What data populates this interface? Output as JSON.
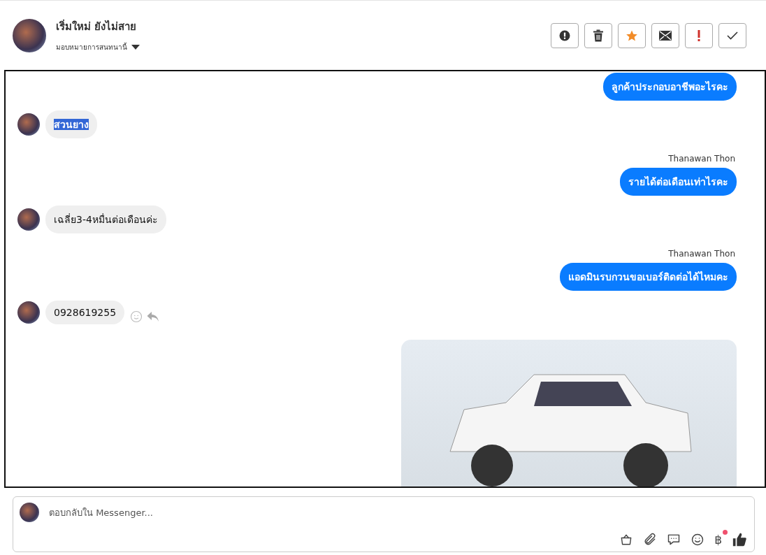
{
  "header": {
    "name": "เริ่มใหม่ ยังไม่สาย",
    "assign_label": "มอบหมายการสนทนานี้"
  },
  "actions": [
    {
      "kind": "alert"
    },
    {
      "kind": "trash"
    },
    {
      "kind": "star"
    },
    {
      "kind": "mail"
    },
    {
      "kind": "exclaim"
    },
    {
      "kind": "check"
    }
  ],
  "messages": [
    {
      "kind": "outgoing",
      "text": "ลูกค้าประกอบอาชีพอะไรคะ"
    },
    {
      "kind": "incoming",
      "text": "สวนยาง",
      "highlighted": true,
      "reactions": false
    },
    {
      "kind": "outgoing",
      "sender": "Thanawan Thon",
      "text": "รายได้ต่อเดือนเท่าไรคะ"
    },
    {
      "kind": "incoming",
      "text": "เฉลี่ย3-4หมื่นต่อเดือนค่ะ",
      "highlighted": false,
      "reactions": false
    },
    {
      "kind": "outgoing",
      "sender": "Thanawan Thon",
      "text": "แอดมินรบกวนขอเบอร์ติดต่อได้ไหมคะ"
    },
    {
      "kind": "incoming",
      "text": "0928619255",
      "highlighted": false,
      "reactions": true
    },
    {
      "kind": "image"
    }
  ],
  "composer": {
    "placeholder": "ตอบกลับใน Messenger...",
    "currency_symbol": "฿",
    "currency_badge": true
  }
}
